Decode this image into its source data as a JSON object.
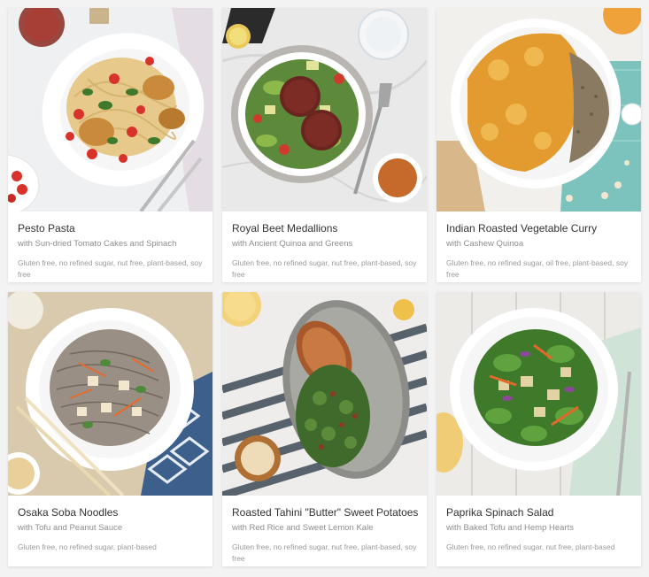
{
  "meals": [
    {
      "title": "Pesto Pasta",
      "subtitle": "with Sun-dried Tomato Cakes and Spinach",
      "tags": "Gluten free, no refined sugar, nut free, plant-based, soy free",
      "image": "pesto-pasta-photo"
    },
    {
      "title": "Royal Beet Medallions",
      "subtitle": "with Ancient Quinoa and Greens",
      "tags": "Gluten free, no refined sugar, nut free, plant-based, soy free",
      "image": "royal-beet-medallions-photo"
    },
    {
      "title": "Indian Roasted Vegetable Curry",
      "subtitle": "with Cashew Quinoa",
      "tags": "Gluten free, no refined sugar, oil free, plant-based, soy free",
      "image": "vegetable-curry-photo"
    },
    {
      "title": "Osaka Soba Noodles",
      "subtitle": "with Tofu and Peanut Sauce",
      "tags": "Gluten free, no refined sugar, plant-based",
      "image": "soba-noodles-photo"
    },
    {
      "title": "Roasted Tahini \"Butter\" Sweet Potatoes",
      "subtitle": "with Red Rice and Sweet Lemon Kale",
      "tags": "Gluten free, no refined sugar, nut free, plant-based, soy free",
      "image": "sweet-potatoes-photo"
    },
    {
      "title": "Paprika Spinach Salad",
      "subtitle": "with Baked Tofu and Hemp Hearts",
      "tags": "Gluten free, no refined sugar, nut free, plant-based",
      "image": "spinach-salad-photo"
    }
  ]
}
